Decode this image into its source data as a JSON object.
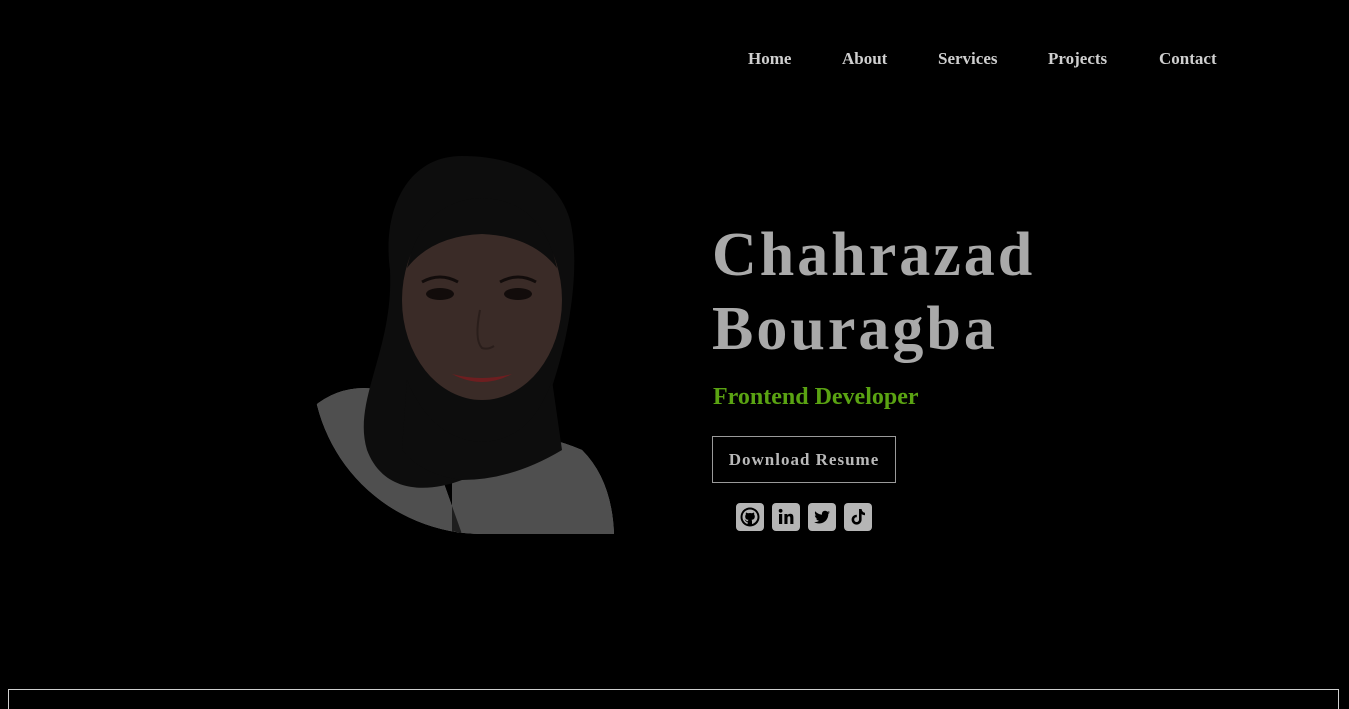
{
  "nav": {
    "items": [
      {
        "label": "Home"
      },
      {
        "label": "About"
      },
      {
        "label": "Services"
      },
      {
        "label": "Projects"
      },
      {
        "label": "Contact"
      }
    ]
  },
  "hero": {
    "name_line1": "Chahrazad",
    "name_line2": "Bouragba",
    "role": "Frontend Developer",
    "resume_label": "Download Resume",
    "photo_alt": "Chahrazad Bouragba"
  },
  "socials": [
    {
      "icon": "github-icon"
    },
    {
      "icon": "linkedin-icon"
    },
    {
      "icon": "twitter-icon"
    },
    {
      "icon": "tiktok-icon"
    }
  ],
  "colors": {
    "background": "#000000",
    "nav_text": "#cfcfcf",
    "name_text": "#a9a9a9",
    "accent": "#5aa312",
    "button_border": "#9a9a9a",
    "icon_fill": "#b5b5b5"
  }
}
